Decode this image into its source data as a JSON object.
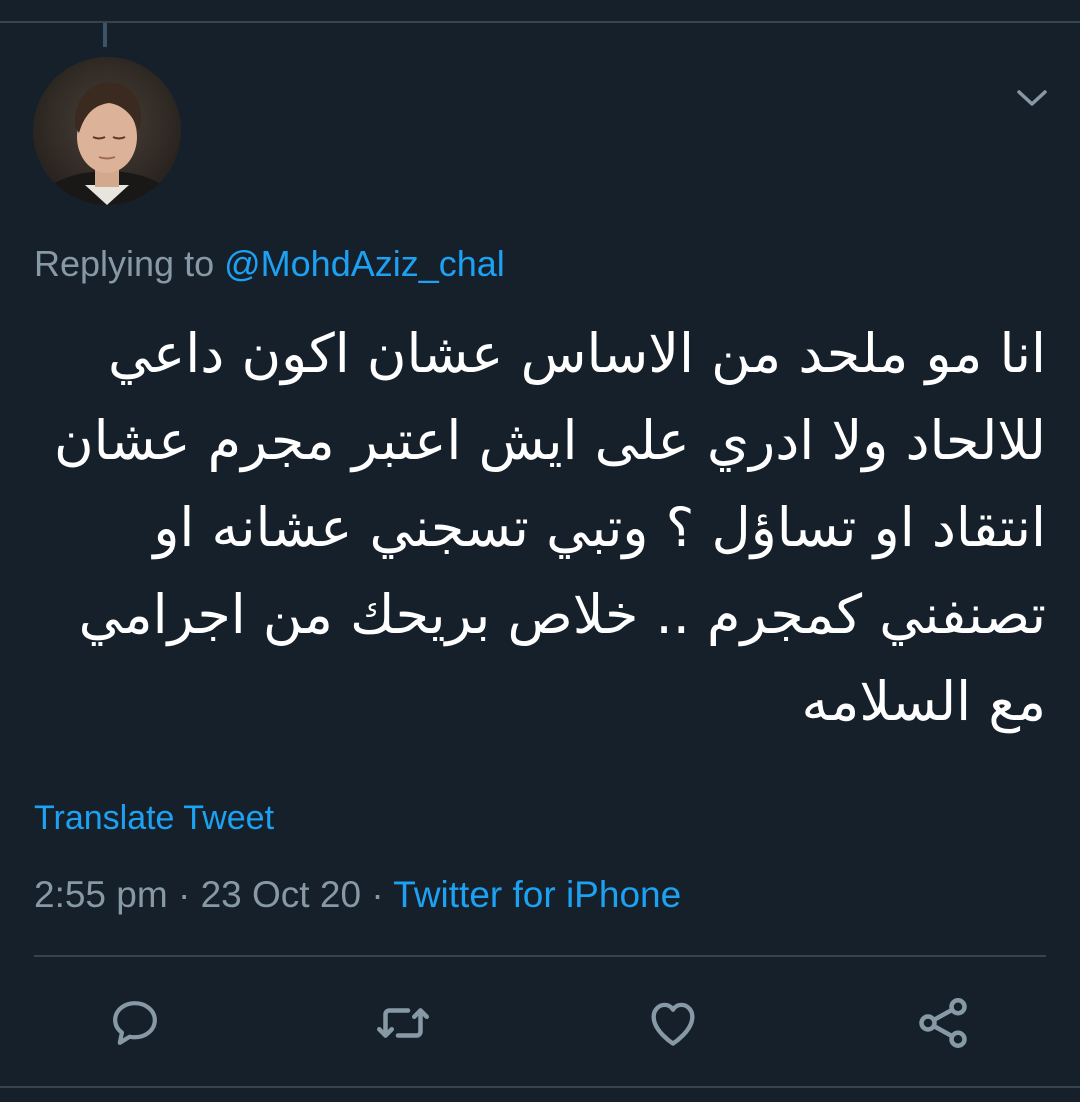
{
  "colors": {
    "background": "#15202b",
    "divider": "#38444d",
    "secondary_text": "#8899a6",
    "link": "#1da1f2",
    "icon": "#8899a6",
    "text": "#ffffff"
  },
  "header": {
    "avatar_alt": "profile photo",
    "menu_icon": "chevron-down-icon"
  },
  "tweet": {
    "replying_prefix": "Replying to",
    "replying_handle": "@MohdAziz_chal",
    "text_lines": [
      "انا مو ملحد من الاساس عشان اكون داعي",
      "للالحاد ولا ادري على ايش اعتبر مجرم عشان",
      "انتقاد او تساؤل ؟ وتبي تسجني عشانه او",
      "تصنفني كمجرم .. خلاص بريحك من اجرامي",
      "مع السلامه"
    ],
    "translate_label": "Translate Tweet",
    "time": "2:55 pm",
    "separator": "·",
    "date": "23 Oct 20",
    "source": "Twitter for iPhone"
  },
  "actions": [
    {
      "name": "reply",
      "icon": "speech-bubble-icon"
    },
    {
      "name": "retweet",
      "icon": "retweet-arrows-icon"
    },
    {
      "name": "like",
      "icon": "heart-icon"
    },
    {
      "name": "share",
      "icon": "share-nodes-icon"
    }
  ]
}
